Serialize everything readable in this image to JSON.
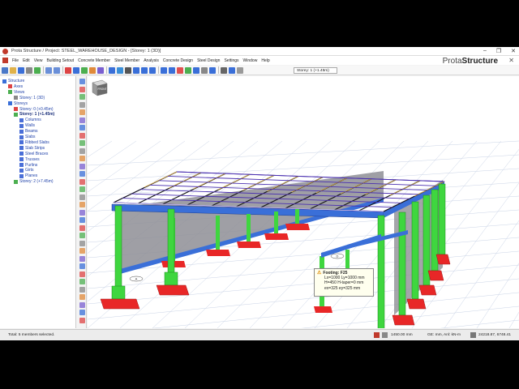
{
  "window": {
    "title": "Prota Structure / Project: STEEL_WAREHOUSE_DESIGN - [Storey: 1 (3D)]",
    "controls": [
      "–",
      "❐",
      "✕"
    ]
  },
  "menu": {
    "items": [
      "File",
      "Edit",
      "View",
      "Building Setout",
      "Concrete Member",
      "Steel Member",
      "Analysis",
      "Concrete Design",
      "Steel Design",
      "Settings",
      "Window",
      "Help"
    ],
    "brand_light": "Prota",
    "brand_bold": "Structure",
    "close_glyph": "✕"
  },
  "toolbar": {
    "storey_selector": "Storey: 1 (+1.45m)"
  },
  "tree": {
    "items": [
      {
        "label": "Structure",
        "level": 0
      },
      {
        "label": "Axes",
        "level": 1
      },
      {
        "label": "Views",
        "level": 1
      },
      {
        "label": "Storey: 1 (3D)",
        "level": 2
      },
      {
        "label": "Storeys",
        "level": 1
      },
      {
        "label": "Storey: 0 (+0.45m)",
        "level": 2
      },
      {
        "label": "Storey: 1 (+1.45m)",
        "level": 2,
        "active": true
      },
      {
        "label": "Columns",
        "level": 3
      },
      {
        "label": "Walls",
        "level": 3
      },
      {
        "label": "Beams",
        "level": 3
      },
      {
        "label": "Slabs",
        "level": 3
      },
      {
        "label": "Ribbed Slabs",
        "level": 3
      },
      {
        "label": "Slab Strips",
        "level": 3
      },
      {
        "label": "Steel Braces",
        "level": 3
      },
      {
        "label": "Trusses",
        "level": 3
      },
      {
        "label": "Purlins",
        "level": 3
      },
      {
        "label": "Girts",
        "level": 3
      },
      {
        "label": "Planes",
        "level": 3
      },
      {
        "label": "Storey: 2 (+7.45m)",
        "level": 2
      }
    ]
  },
  "viewport": {
    "cube_label": "FRONT",
    "axis_markers": [
      "A",
      "B",
      "C",
      "D"
    ],
    "tooltip": {
      "title": "Footing: F25",
      "lines": [
        "Lx=1000  Ly=1000 mm",
        "H=450  H-taper=0 mm",
        "ex=325  ey=325 mm"
      ]
    }
  },
  "statusbar": {
    "left": "Total: 5 members selected.",
    "value": "1450.00 mm",
    "units": "GE: mm,  Anl: kN-m",
    "coords": "24218.87, 6748.41"
  },
  "colors": {
    "column": "#3fd63f",
    "footing": "#e82727",
    "beam": "#3a6fd8",
    "truss": "#1a1a1a",
    "purlin": "#4a2fb0",
    "cladding": "#8e8e95"
  }
}
